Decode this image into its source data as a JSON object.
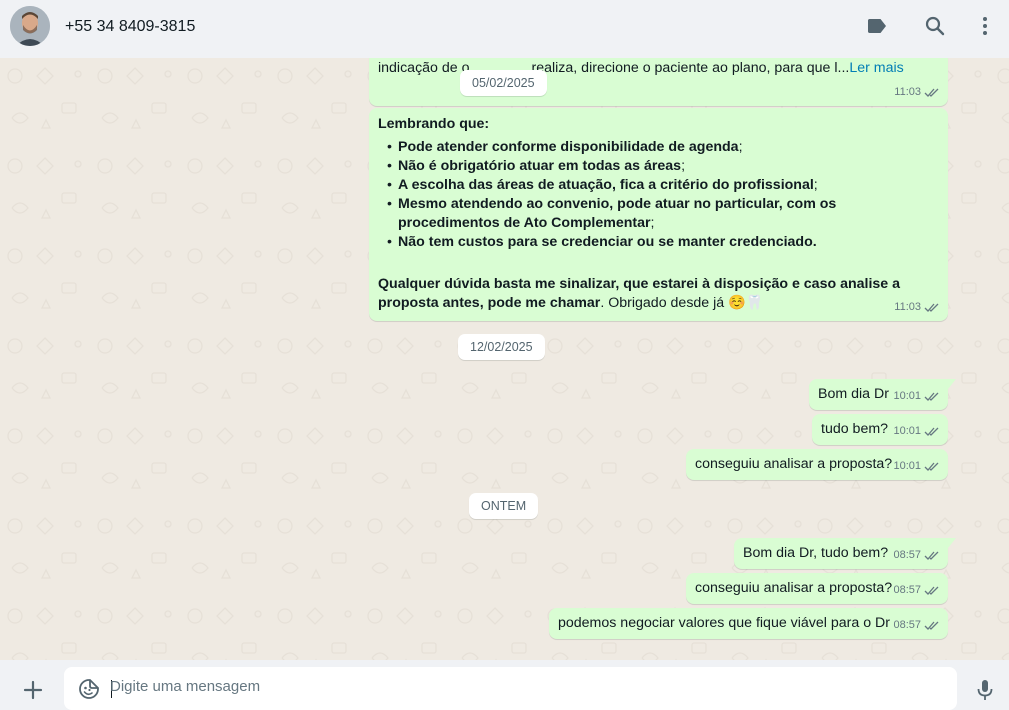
{
  "header": {
    "contact_name": "+55 34 8409-3815",
    "icons": [
      "label-icon",
      "search-icon",
      "menu-icon"
    ]
  },
  "messages": {
    "m1": {
      "text": "indicação de ",
      "text_hidden": "o",
      "text_tail": "realiza, direcione o paciente ao plano, para que l...",
      "read_more": "Ler mais",
      "time": "11:03"
    },
    "date1": "05/02/2025",
    "m2": {
      "intro": "Lembrando que:",
      "items": [
        {
          "bold": "Pode atender conforme disponibilidade de agenda",
          "rest": ";"
        },
        {
          "bold": "Não é obrigatório atuar em todas as áreas",
          "rest": ";"
        },
        {
          "bold": "A escolha das áreas de atuação, fica a critério do profissional",
          "rest": ";"
        },
        {
          "bold": "Mesmo atendendo ao convenio, pode atuar no particular, com os procedimentos de Ato Complementar",
          "rest": ";"
        },
        {
          "bold": "Não tem custos para se credenciar ou se manter credenciado.",
          "rest": ""
        }
      ],
      "closing_bold": "Qualquer dúvida basta me sinalizar, que estarei à disposição e caso analise a proposta antes, pode me chamar",
      "closing_rest": ". Obrigado desde já ☺️🦷",
      "time": "11:03"
    },
    "date2": "12/02/2025",
    "m3": {
      "text": "Bom dia Dr",
      "time": "10:01"
    },
    "m4": {
      "text": "tudo bem?",
      "time": "10:01"
    },
    "m5": {
      "text": "conseguiu analisar a proposta?",
      "time": "10:01"
    },
    "date3": "ONTEM",
    "m6": {
      "text": "Bom dia Dr, tudo bem?",
      "time": "08:57"
    },
    "m7": {
      "text": "conseguiu analisar a proposta?",
      "time": "08:57"
    },
    "m8": {
      "text": "podemos negociar valores que fique viável para o Dr",
      "time": "08:57"
    }
  },
  "footer": {
    "placeholder": "Digite uma mensagem",
    "icons": [
      "plus-icon",
      "emoji-icon",
      "mic-icon"
    ]
  },
  "colors": {
    "outgoing_bubble": "#d9fdd3",
    "chat_bg": "#efeae2",
    "header_bg": "#f0f2f5",
    "link": "#027eb5",
    "read_ticks": "#667781"
  }
}
